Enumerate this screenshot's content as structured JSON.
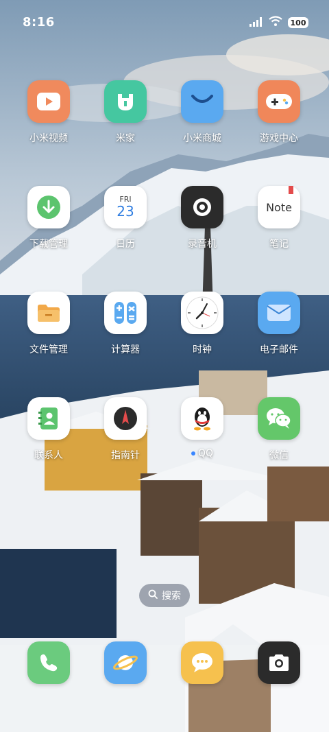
{
  "status_bar": {
    "time": "8:16",
    "battery": "100"
  },
  "apps": [
    {
      "name": "小米视频",
      "icon": "video-play-icon",
      "color": "#F08A5D"
    },
    {
      "name": "米家",
      "icon": "mijia-icon",
      "color": "#45C7A0"
    },
    {
      "name": "小米商城",
      "icon": "shop-smile-icon",
      "color": "#5AA9F0"
    },
    {
      "name": "游戏中心",
      "icon": "gamepad-icon",
      "color": "#F0875A"
    },
    {
      "name": "下载管理",
      "icon": "download-icon",
      "color": "#FFFFFF"
    },
    {
      "name": "日历",
      "icon": "calendar-icon",
      "color": "#FFFFFF",
      "day": "FRI",
      "date": "23"
    },
    {
      "name": "录音机",
      "icon": "recorder-icon",
      "color": "#2B2B2B"
    },
    {
      "name": "笔记",
      "icon": "notes-icon",
      "color": "#FFFFFF",
      "text": "Note"
    },
    {
      "name": "文件管理",
      "icon": "folder-icon",
      "color": "#FFFFFF"
    },
    {
      "name": "计算器",
      "icon": "calculator-icon",
      "color": "#FFFFFF"
    },
    {
      "name": "时钟",
      "icon": "clock-icon",
      "color": "#FFFFFF"
    },
    {
      "name": "电子邮件",
      "icon": "mail-icon",
      "color": "#5AA9F0"
    },
    {
      "name": "联系人",
      "icon": "contacts-icon",
      "color": "#FFFFFF"
    },
    {
      "name": "指南针",
      "icon": "compass-icon",
      "color": "#FFFFFF"
    },
    {
      "name": "QQ",
      "icon": "qq-penguin-icon",
      "color": "#FFFFFF"
    },
    {
      "name": "微信",
      "icon": "wechat-icon",
      "color": "#64C76A"
    }
  ],
  "search": {
    "label": "搜索"
  },
  "dock": [
    {
      "icon": "phone-icon",
      "color": "#6BCB7E"
    },
    {
      "icon": "browser-planet-icon",
      "color": "#5AA9F0"
    },
    {
      "icon": "messages-icon",
      "color": "#F6C14E"
    },
    {
      "icon": "camera-icon",
      "color": "#2B2B2B"
    }
  ]
}
